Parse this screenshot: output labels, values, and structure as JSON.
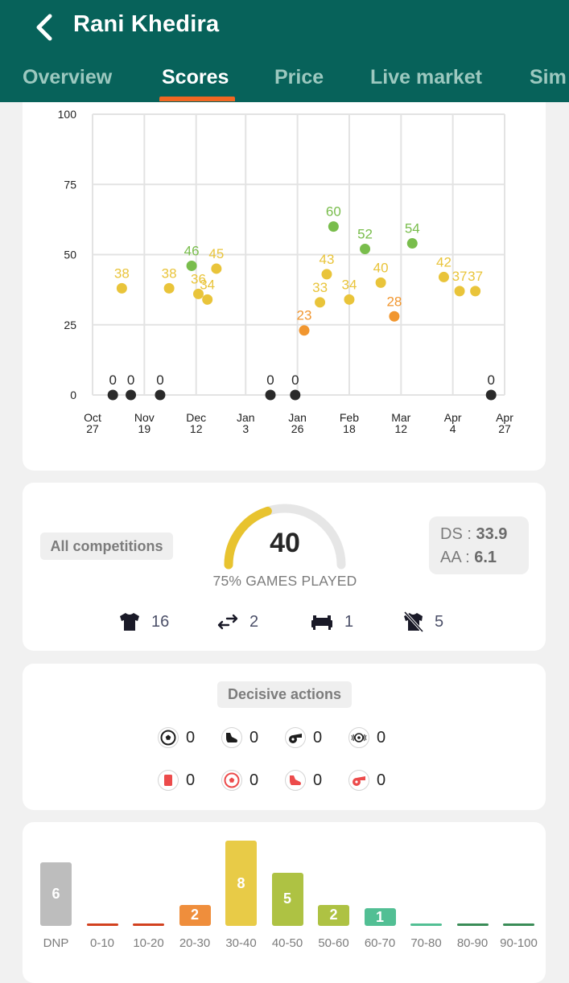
{
  "header": {
    "title": "Rani Khedira",
    "back_icon": "chevron-left-icon",
    "tabs": [
      {
        "label": "Overview",
        "active": false
      },
      {
        "label": "Scores",
        "active": true
      },
      {
        "label": "Price",
        "active": false
      },
      {
        "label": "Live market",
        "active": false
      },
      {
        "label": "Sim",
        "active": false
      }
    ],
    "colors": {
      "background": "#07625a",
      "active_underline": "#f26722"
    }
  },
  "chart_data": {
    "type": "scatter",
    "title": "",
    "xlabel": "",
    "ylabel": "",
    "ylim": [
      0,
      100
    ],
    "yticks": [
      0,
      25,
      50,
      75,
      100
    ],
    "x_unit": "days since Oct 27",
    "xlim": [
      0,
      184
    ],
    "xticks": [
      {
        "day": 0,
        "line1": "Oct",
        "line2": "27"
      },
      {
        "day": 23,
        "line1": "Nov",
        "line2": "19"
      },
      {
        "day": 46,
        "line1": "Dec",
        "line2": "12"
      },
      {
        "day": 68,
        "line1": "Jan",
        "line2": "3"
      },
      {
        "day": 91,
        "line1": "Jan",
        "line2": "26"
      },
      {
        "day": 114,
        "line1": "Feb",
        "line2": "18"
      },
      {
        "day": 137,
        "line1": "Mar",
        "line2": "12"
      },
      {
        "day": 160,
        "line1": "Apr",
        "line2": "4"
      },
      {
        "day": 183,
        "line1": "Apr",
        "line2": "27"
      }
    ],
    "grid": true,
    "points": [
      {
        "day": 9,
        "value": 0
      },
      {
        "day": 13,
        "value": 38
      },
      {
        "day": 17,
        "value": 0
      },
      {
        "day": 30,
        "value": 0
      },
      {
        "day": 34,
        "value": 38
      },
      {
        "day": 44,
        "value": 46
      },
      {
        "day": 47,
        "value": 36
      },
      {
        "day": 51,
        "value": 34
      },
      {
        "day": 55,
        "value": 45
      },
      {
        "day": 79,
        "value": 0
      },
      {
        "day": 90,
        "value": 0
      },
      {
        "day": 94,
        "value": 23
      },
      {
        "day": 101,
        "value": 33
      },
      {
        "day": 104,
        "value": 43
      },
      {
        "day": 107,
        "value": 60
      },
      {
        "day": 114,
        "value": 34
      },
      {
        "day": 121,
        "value": 52
      },
      {
        "day": 128,
        "value": 40
      },
      {
        "day": 134,
        "value": 28
      },
      {
        "day": 142,
        "value": 54
      },
      {
        "day": 156,
        "value": 42
      },
      {
        "day": 163,
        "value": 37
      },
      {
        "day": 170,
        "value": 37
      },
      {
        "day": 177,
        "value": 0
      }
    ],
    "color_scale": [
      {
        "min": 0,
        "max": 0,
        "color": "#2a2a2a"
      },
      {
        "min": 1,
        "max": 30,
        "color": "#f1962f"
      },
      {
        "min": 30,
        "max": 45,
        "color": "#e9c43a"
      },
      {
        "min": 45,
        "max": 60,
        "color": "#79bd4c"
      },
      {
        "min": 60,
        "max": 100,
        "color": "#3cbd8c"
      }
    ]
  },
  "summary": {
    "competition_filter": "All competitions",
    "gauge": {
      "value": "40",
      "score": 40,
      "max": 100,
      "color": "#e8c32f",
      "track_color": "#e6e6e6"
    },
    "games_played_caption": "75% GAMES PLAYED",
    "ds_label": "DS : ",
    "ds_value": "33.9",
    "aa_label": "AA : ",
    "aa_value": "6.1",
    "stats": [
      {
        "icon": "jersey-icon",
        "value": "16"
      },
      {
        "icon": "substitution-icon",
        "value": "2"
      },
      {
        "icon": "bench-icon",
        "value": "1"
      },
      {
        "icon": "not-played-jersey-icon",
        "value": "5"
      }
    ]
  },
  "decisive_actions": {
    "title": "Decisive actions",
    "positive": [
      {
        "icon": "goal-ball-icon",
        "value": "0"
      },
      {
        "icon": "assist-boot-icon",
        "value": "0"
      },
      {
        "icon": "penalty-won-whistle-icon",
        "value": "0"
      },
      {
        "icon": "clean-sheet-ball-icon",
        "value": "0"
      }
    ],
    "negative": [
      {
        "icon": "red-card-icon",
        "value": "0"
      },
      {
        "icon": "own-goal-ball-icon",
        "value": "0"
      },
      {
        "icon": "error-boot-icon",
        "value": "0"
      },
      {
        "icon": "penalty-conceded-whistle-icon",
        "value": "0"
      }
    ],
    "colors": {
      "positive": "#1d1d1d",
      "negative": "#ec4b4b"
    }
  },
  "distribution": {
    "type": "bar",
    "categories": [
      "DNP",
      "0-10",
      "10-20",
      "20-30",
      "30-40",
      "40-50",
      "50-60",
      "60-70",
      "70-80",
      "80-90",
      "90-100"
    ],
    "values": [
      6,
      0,
      0,
      2,
      8,
      5,
      2,
      1,
      0,
      0,
      0
    ],
    "colors": [
      "#bdbdbd",
      "#d2411f",
      "#d2411f",
      "#ef8e3c",
      "#e8cb47",
      "#aec243",
      "#aec243",
      "#52bf94",
      "#52bf94",
      "#3a8c57",
      "#3a8c57"
    ]
  }
}
